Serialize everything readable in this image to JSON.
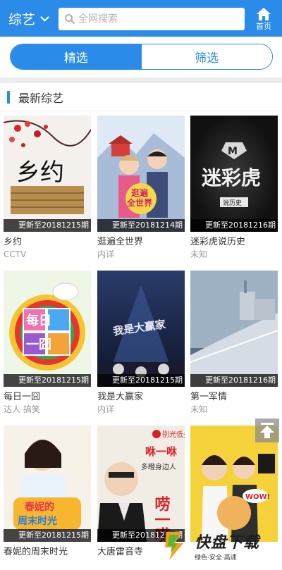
{
  "header": {
    "category_label": "综艺",
    "search_placeholder": "全网搜索",
    "home_label": "首页",
    "accent_color": "#2a8be8"
  },
  "tabs": [
    {
      "label": "精选",
      "active": true
    },
    {
      "label": "筛选",
      "active": false
    }
  ],
  "section": {
    "title": "最新综艺"
  },
  "items": [
    {
      "title": "乡约",
      "sub": "CCTV",
      "badge": "更新至20181215期"
    },
    {
      "title": "逛遍全世界",
      "sub": "内详",
      "badge": "更新至20181214期"
    },
    {
      "title": "迷彩虎说历史",
      "sub": "未知",
      "badge": "更新至20181216期"
    },
    {
      "title": "每日一囧",
      "sub": "达人 搞笑",
      "badge": "更新至20181215期"
    },
    {
      "title": "我是大赢家",
      "sub": "内详",
      "badge": "更新至20181215期"
    },
    {
      "title": "第一军情",
      "sub": "未知",
      "badge": "更新至20181216期"
    },
    {
      "title": "春妮的周末时光",
      "sub": "",
      "badge": "更新至20181215期"
    },
    {
      "title": "大唐雷音寺",
      "sub": "",
      "badge": "更新至20181215期"
    },
    {
      "title": "",
      "sub": "",
      "badge": ""
    }
  ],
  "poster_text": {
    "p1": "乡约",
    "p2a": "逛遍",
    "p2b": "全世界",
    "p3a": "迷彩虎",
    "p3b": "说历史",
    "p4a": "每日",
    "p4b": "一囧",
    "p5": "我是大赢家",
    "p7a": "春妮的",
    "p7b": "周末时光",
    "p8a": "别光低头",
    "p8b": "咻一咻",
    "p8c": "多瞪身边人",
    "p8d": "唠一唠",
    "p9": "WOW!"
  },
  "watermark": {
    "name": "快盘下载",
    "tagline": "绿色·安全·高速"
  }
}
